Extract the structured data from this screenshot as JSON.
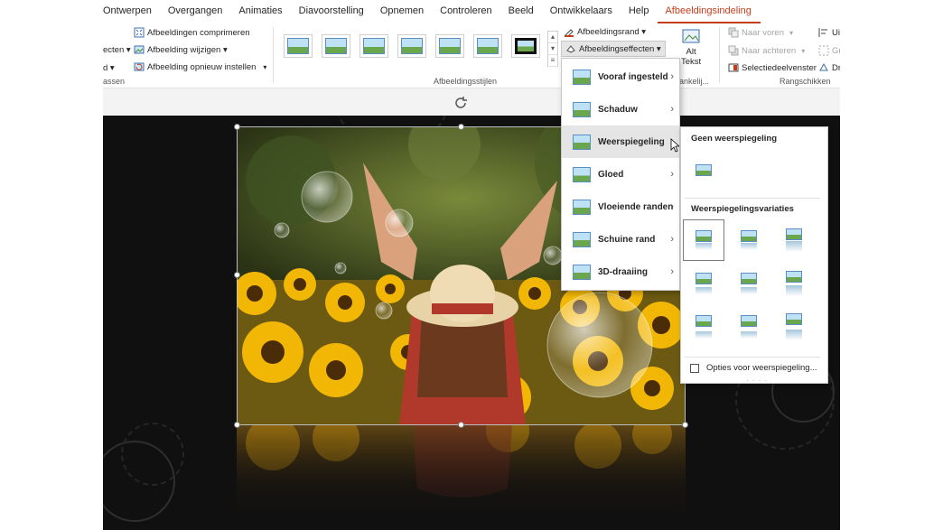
{
  "tabs": [
    "Ontwerpen",
    "Overgangen",
    "Animaties",
    "Diavoorstelling",
    "Opnemen",
    "Controleren",
    "Beeld",
    "Ontwikkelaars",
    "Help",
    "Afbeeldingsindeling"
  ],
  "active_tab": "Afbeeldingsindeling",
  "ribbon": {
    "adjust": {
      "left_cut_top": "ecten ▾",
      "left_cut_mid": "d ▾",
      "group_label_cut": "assen",
      "compress": "Afbeeldingen comprimeren",
      "change": "Afbeelding wijzigen ▾",
      "reset": "Afbeelding opnieuw instellen"
    },
    "styles_label": "Afbeeldingsstijlen",
    "border_btn": "Afbeeldingsrand ▾",
    "effects_btn": "Afbeeldingseffecten ▾",
    "alt_text_1": "Alt",
    "alt_text_2": "Tekst",
    "accessibility_label_cut": "egankelij...",
    "arrange": {
      "bring_forward": "Naar voren",
      "send_backward": "Naar achteren",
      "selection_pane": "Selectiedeelvenster",
      "align_cut": "Ui",
      "group_cut": "Gr",
      "rotate_cut": "Dr",
      "label": "Rangschikken"
    }
  },
  "effects_menu": {
    "items": [
      {
        "label": "Vooraf ingesteld",
        "icon": "picture-icon"
      },
      {
        "label": "Schaduw",
        "icon": "picture-icon"
      },
      {
        "label": "Weerspiegeling",
        "icon": "picture-icon"
      },
      {
        "label": "Gloed",
        "icon": "picture-icon"
      },
      {
        "label": "Vloeiende randen",
        "icon": "picture-icon"
      },
      {
        "label": "Schuine rand",
        "icon": "picture-icon"
      },
      {
        "label": "3D-draaiing",
        "icon": "picture-icon"
      }
    ],
    "hovered": "Weerspiegeling"
  },
  "reflection_submenu": {
    "none_heading": "Geen weerspiegeling",
    "variations_heading": "Weerspiegelingsvariaties",
    "options_link": "Opties voor weerspiegeling..."
  },
  "colors": {
    "accent": "#c43e1c",
    "slide_bg": "#101010",
    "menu_hover": "#e5e5e5"
  }
}
